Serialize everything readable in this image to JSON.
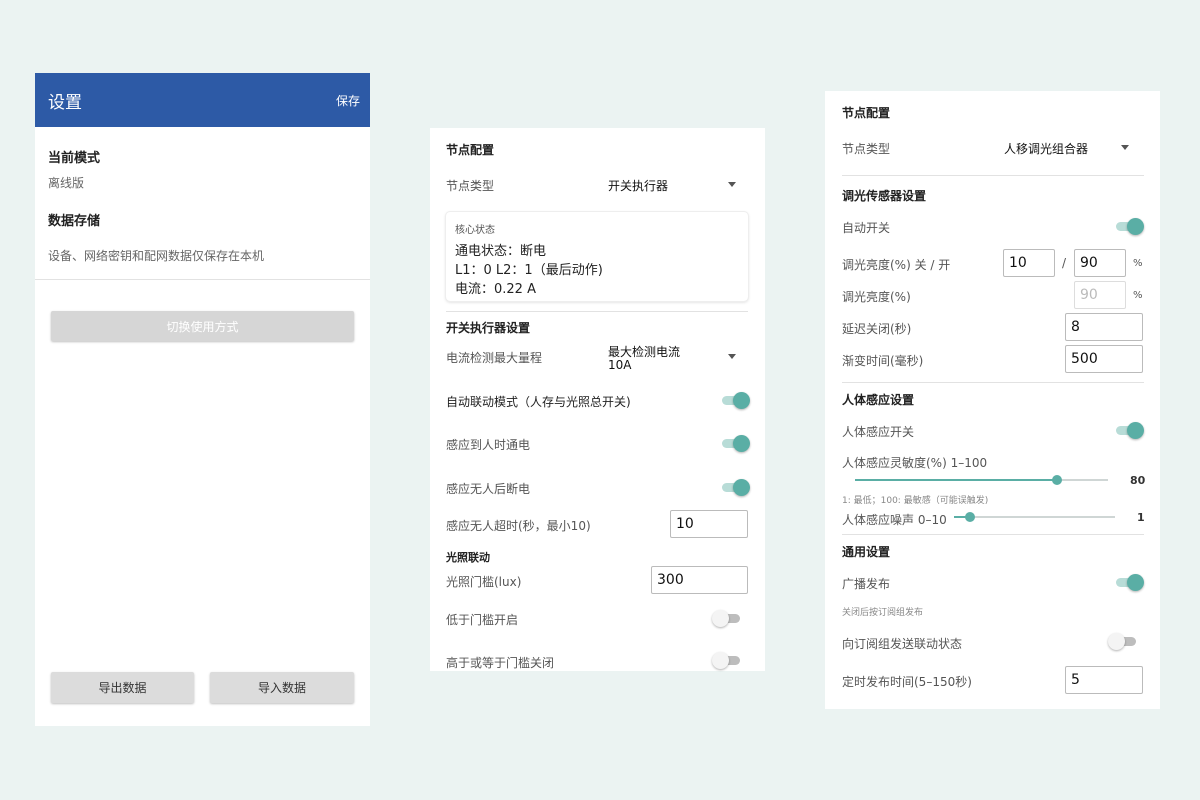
{
  "settings": {
    "title": "设置",
    "save_label": "保存",
    "mode_heading": "当前模式",
    "mode_value": "离线版",
    "storage_heading": "数据存储",
    "storage_desc": "设备、网络密钥和配网数据仅保存在本机",
    "switch_button": "切换使用方式",
    "export_button": "导出数据",
    "import_button": "导入数据"
  },
  "switch_node": {
    "title": "节点配置",
    "type_label": "节点类型",
    "type_value": "开关执行器",
    "status": {
      "heading": "核心状态",
      "power_line": "通电状态：断电",
      "relay_line": "L1：0  L2：1（最后动作)",
      "current_line": "电流：0.22 A"
    },
    "settings_heading": "开关执行器设置",
    "current_range_label": "电流检测最大量程",
    "current_range_value_1": "最大检测电流",
    "current_range_value_2": "10A",
    "auto_link_label": "自动联动模式（人存与光照总开关)",
    "auto_link_on": true,
    "person_on_label": "感应到人时通电",
    "person_on": true,
    "no_person_off_label": "感应无人后断电",
    "no_person_off": true,
    "timeout_label": "感应无人超时(秒，最小10)",
    "timeout_value": "10",
    "light_heading": "光照联动",
    "lux_label": "光照门槛(lux)",
    "lux_value": "300",
    "below_on_label": "低于门槛开启",
    "below_on": false,
    "above_off_label": "高于或等于门槛关闭",
    "above_off": false
  },
  "dimmer_node": {
    "title": "节点配置",
    "type_label": "节点类型",
    "type_value": "人移调光组合器",
    "dim_heading": "调光传感器设置",
    "auto_switch_label": "自动开关",
    "auto_switch_on": true,
    "brightness_range_label": "调光亮度(%) 关 / 开",
    "brightness_off_value": "10",
    "slash": "/",
    "brightness_on_value": "90",
    "percent": "%",
    "brightness_label": "调光亮度(%)",
    "brightness_value": "90",
    "delay_label": "延迟关闭(秒)",
    "delay_value": "8",
    "fade_label": "渐变时间(毫秒)",
    "fade_value": "500",
    "human_heading": "人体感应设置",
    "human_switch_label": "人体感应开关",
    "human_switch_on": true,
    "sensitivity_label": "人体感应灵敏度(%) 1–100",
    "sensitivity_value": 80,
    "sensitivity_display": "80",
    "sensitivity_hint": "1: 最低；100: 最敏感（可能误触发)",
    "noise_label": "人体感应噪声 0–10",
    "noise_value": 1,
    "noise_display": "1",
    "general_heading": "通用设置",
    "broadcast_label": "广播发布",
    "broadcast_on": true,
    "broadcast_hint": "关闭后按订阅组发布",
    "send_state_label": "向订阅组发送联动状态",
    "send_state_on": false,
    "publish_interval_label": "定时发布时间(5–150秒)",
    "publish_interval_value": "5"
  },
  "colors": {
    "appbar": "#2d5aa6",
    "accent": "#5aaea5",
    "background": "#ebf3f2"
  }
}
